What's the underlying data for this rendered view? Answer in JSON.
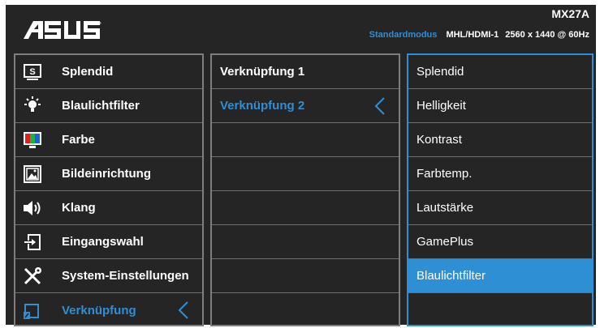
{
  "header": {
    "model": "MX27A",
    "mode": "Standardmodus",
    "input": "MHL/HDMI-1",
    "resolution": "2560 x 1440 @ 60Hz"
  },
  "main_menu": [
    {
      "label": "Splendid",
      "icon": "splendid-icon"
    },
    {
      "label": "Blaulichtfilter",
      "icon": "bulb-icon"
    },
    {
      "label": "Farbe",
      "icon": "color-icon"
    },
    {
      "label": "Bildeinrichtung",
      "icon": "image-icon"
    },
    {
      "label": "Klang",
      "icon": "speaker-icon"
    },
    {
      "label": "Eingangswahl",
      "icon": "input-icon"
    },
    {
      "label": "System-Einstellungen",
      "icon": "tools-icon"
    },
    {
      "label": "Verknüpfung",
      "icon": "shortcut-icon"
    }
  ],
  "sub_menu": [
    {
      "label": "Verknüpfung 1"
    },
    {
      "label": "Verknüpfung 2"
    }
  ],
  "options": [
    {
      "label": "Splendid"
    },
    {
      "label": "Helligkeit"
    },
    {
      "label": "Kontrast"
    },
    {
      "label": "Farbtemp."
    },
    {
      "label": "Lautstärke"
    },
    {
      "label": "GamePlus"
    },
    {
      "label": "Blaulichtfilter"
    }
  ],
  "colors": {
    "accent": "#2f8fd4",
    "background": "#252525",
    "border": "#7e7e7e"
  }
}
